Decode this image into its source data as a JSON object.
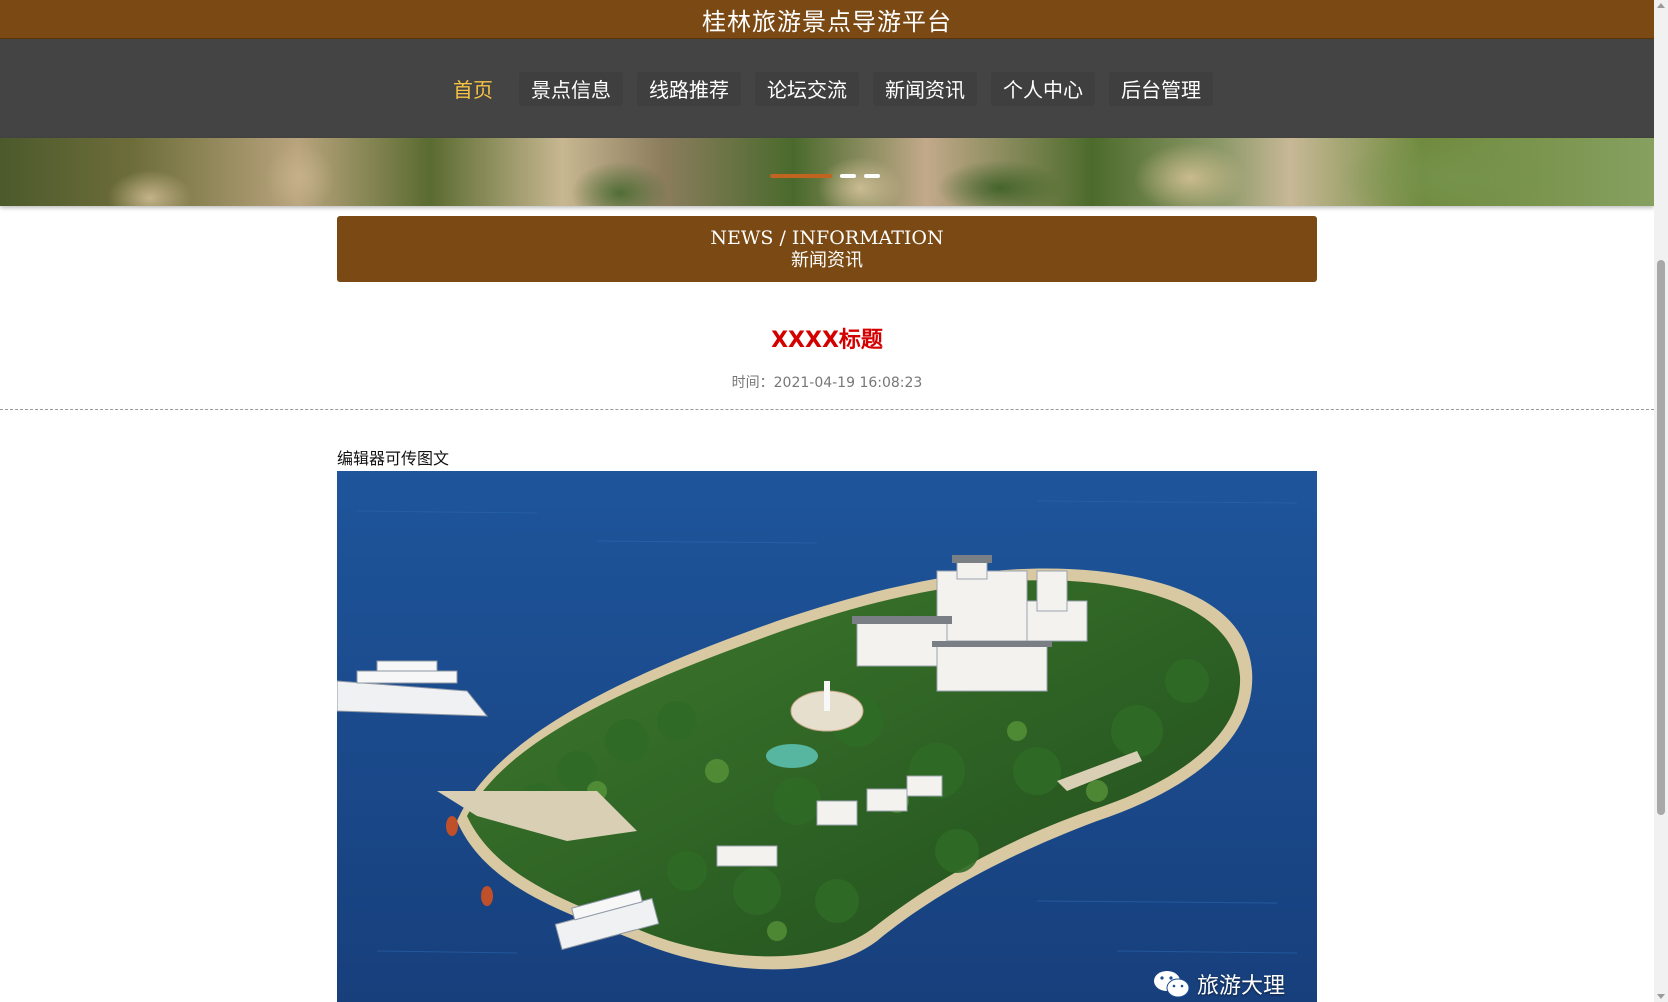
{
  "site": {
    "title": "桂林旅游景点导游平台"
  },
  "nav": {
    "items": [
      {
        "label": "首页",
        "active": true
      },
      {
        "label": "景点信息",
        "active": false
      },
      {
        "label": "线路推荐",
        "active": false
      },
      {
        "label": "论坛交流",
        "active": false
      },
      {
        "label": "新闻资讯",
        "active": false
      },
      {
        "label": "个人中心",
        "active": false
      },
      {
        "label": "后台管理",
        "active": false
      }
    ]
  },
  "banner": {
    "slide_count": 3,
    "active_slide": 1
  },
  "section": {
    "title_en": "NEWS / INFORMATION",
    "title_cn": "新闻资讯"
  },
  "article": {
    "title": "XXXX标题",
    "time": "时间：2021-04-19 16:08:23",
    "body_text": "编辑器可传图文",
    "image_watermark": "旅游大理"
  },
  "colors": {
    "brand_brown": "#7b4a14",
    "nav_bg": "#444444",
    "nav_active": "#f6c344",
    "title_red": "#d40000"
  },
  "icons": {
    "watermark_icon": "wechat-icon"
  }
}
